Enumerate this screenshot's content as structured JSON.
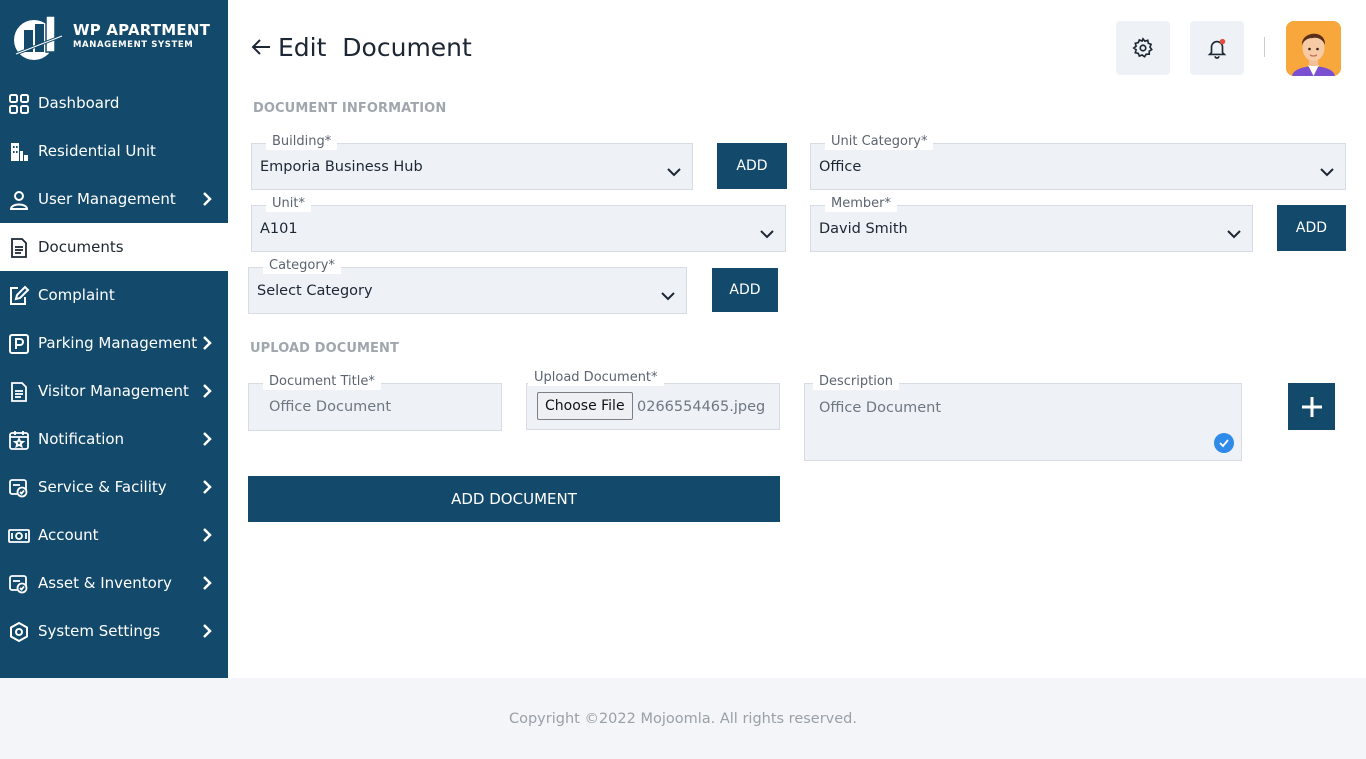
{
  "brand": {
    "title": "WP APARTMENT",
    "subtitle": "MANAGEMENT SYSTEM"
  },
  "sidebar": {
    "items": [
      {
        "label": "Dashboard",
        "icon": "grid-icon",
        "has_chevron": false
      },
      {
        "label": "Residential Unit",
        "icon": "building-icon",
        "has_chevron": false
      },
      {
        "label": "User Management",
        "icon": "user-icon",
        "has_chevron": true
      },
      {
        "label": "Documents",
        "icon": "document-icon",
        "has_chevron": false,
        "active": true
      },
      {
        "label": "Complaint",
        "icon": "edit-icon",
        "has_chevron": false
      },
      {
        "label": "Parking Management",
        "icon": "parking-icon",
        "has_chevron": true
      },
      {
        "label": "Visitor Management",
        "icon": "clipboard-icon",
        "has_chevron": true
      },
      {
        "label": "Notification",
        "icon": "calendar-star-icon",
        "has_chevron": true
      },
      {
        "label": "Service & Facility",
        "icon": "service-icon",
        "has_chevron": true
      },
      {
        "label": "Account",
        "icon": "cash-icon",
        "has_chevron": true
      },
      {
        "label": "Asset & Inventory",
        "icon": "asset-icon",
        "has_chevron": true
      },
      {
        "label": "System Settings",
        "icon": "settings-eye-icon",
        "has_chevron": true
      }
    ]
  },
  "header": {
    "title": "Edit  Document"
  },
  "form": {
    "section1": "DOCUMENT INFORMATION",
    "building": {
      "label": "Building*",
      "value": "Emporia Business Hub"
    },
    "unit_category": {
      "label": "Unit Category*",
      "value": "Office"
    },
    "unit": {
      "label": "Unit*",
      "value": "A101"
    },
    "member": {
      "label": "Member*",
      "value": "David Smith"
    },
    "category": {
      "label": "Category*",
      "value": "Select Category"
    },
    "add_label": "ADD",
    "section2": "UPLOAD DOCUMENT",
    "doc_title": {
      "label": "Document Title*",
      "value": "Office Document"
    },
    "upload": {
      "label": "Upload Document*",
      "button": "Choose File",
      "file": "0266554465.jpeg"
    },
    "description": {
      "label": "Description",
      "value": "Office Document"
    },
    "submit_label": "ADD DOCUMENT"
  },
  "footer": {
    "text": "Copyright ©2022 Mojoomla. All rights reserved."
  },
  "colors": {
    "primary": "#134a6c",
    "field_bg": "#eef1f6",
    "accent_orange": "#f7a73b",
    "check_blue": "#2f8ae8"
  }
}
